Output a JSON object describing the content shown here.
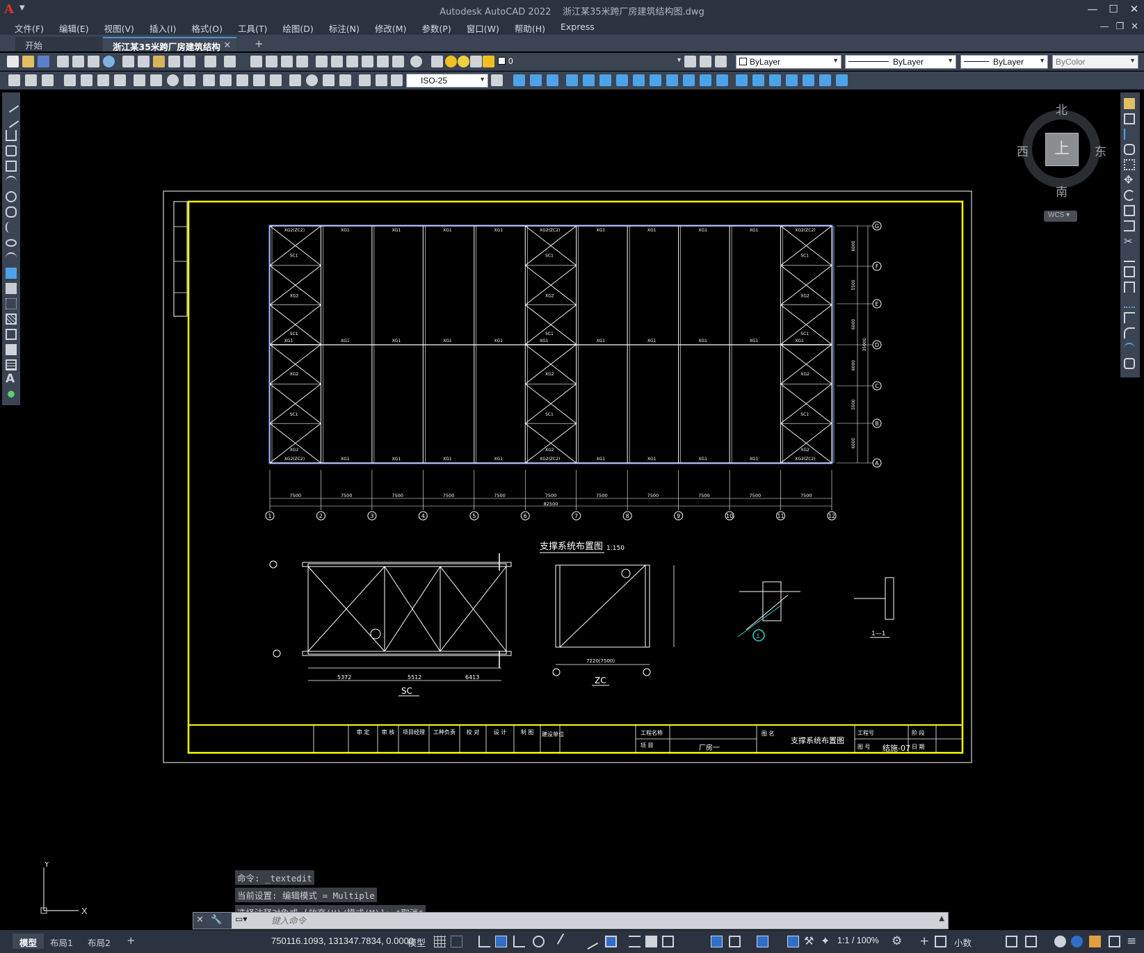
{
  "window": {
    "app_title": "Autodesk AutoCAD 2022",
    "doc_title": "浙江某35米跨厂房建筑结构图.dwg",
    "logo": "A"
  },
  "menu": [
    "文件(F)",
    "编辑(E)",
    "视图(V)",
    "插入(I)",
    "格式(O)",
    "工具(T)",
    "绘图(D)",
    "标注(N)",
    "修改(M)",
    "参数(P)",
    "窗口(W)",
    "帮助(H)",
    "Express"
  ],
  "tabs": {
    "start": "开始",
    "doc": "浙江某35米跨厂房建筑结构图*",
    "close": "✕",
    "add": "+"
  },
  "toolbar": {
    "layer": "0",
    "color": "ByLayer",
    "linetype": "ByLayer",
    "lineweight": "ByLayer",
    "plotstyle": "ByColor",
    "dimstyle": "ISO-25"
  },
  "viewcube": {
    "north": "北",
    "south": "南",
    "east": "东",
    "west": "西",
    "top": "上",
    "wcs": "WCS"
  },
  "drawing": {
    "plan_axes_x": [
      "1",
      "2",
      "3",
      "4",
      "5",
      "6",
      "7",
      "8",
      "9",
      "10",
      "11",
      "12"
    ],
    "plan_axes_y": [
      "G",
      "F",
      "E",
      "D",
      "C",
      "B",
      "A"
    ],
    "bay_dim": "7500",
    "total_dim": "82500",
    "y_dims": [
      "6000",
      "5500",
      "6000",
      "6000",
      "5500",
      "6000"
    ],
    "total_y": "35000",
    "member_xg": "XG1",
    "member_xg2": "XG2",
    "member_sc": "SC1",
    "member_top": "XG2(ZC2)",
    "title_plan": "支撑系统布置图",
    "scale_plan": "1:150",
    "detail_sc_label": "SC",
    "detail_zc_label": "ZC",
    "sc_dims": [
      "5372",
      "5512",
      "6413"
    ],
    "zc_dim": "7220(7500)",
    "section_label": "1—1",
    "detail_marker": "1",
    "titleblock": {
      "approved": "审 定",
      "verify": "审 核",
      "manager": "项目经理",
      "chief": "工种负责",
      "checked": "校 对",
      "design": "设 计",
      "drawn": "制 图",
      "unit": "建设单位",
      "project": "工程名称",
      "item": "项 目",
      "item_value": "厂房一",
      "drawing_name_label": "图 名",
      "drawing_name": "支撑系统布置图",
      "project_no": "工程号",
      "drawing_no_label": "图 号",
      "drawing_no": "结施-07",
      "stage": "阶 段",
      "date": "日 期"
    }
  },
  "command": {
    "history": [
      "命令: _textedit",
      "当前设置: 编辑模式 = Multiple",
      "选择注释对象或 [放弃(U)/模式(M)]: *取消*"
    ],
    "placeholder": "键入命令"
  },
  "status": {
    "layouts": [
      "模型",
      "布局1",
      "布局2"
    ],
    "add": "+",
    "coords": "750116.1093, 131347.7834, 0.0000",
    "model": "模型",
    "scale": "1:1 / 100%",
    "units": "小数"
  },
  "colors": {
    "frame_yellow": "#ffff00",
    "select_blue": "#4a6fe0",
    "canvas": "#000000",
    "chrome": "#3b4453"
  }
}
